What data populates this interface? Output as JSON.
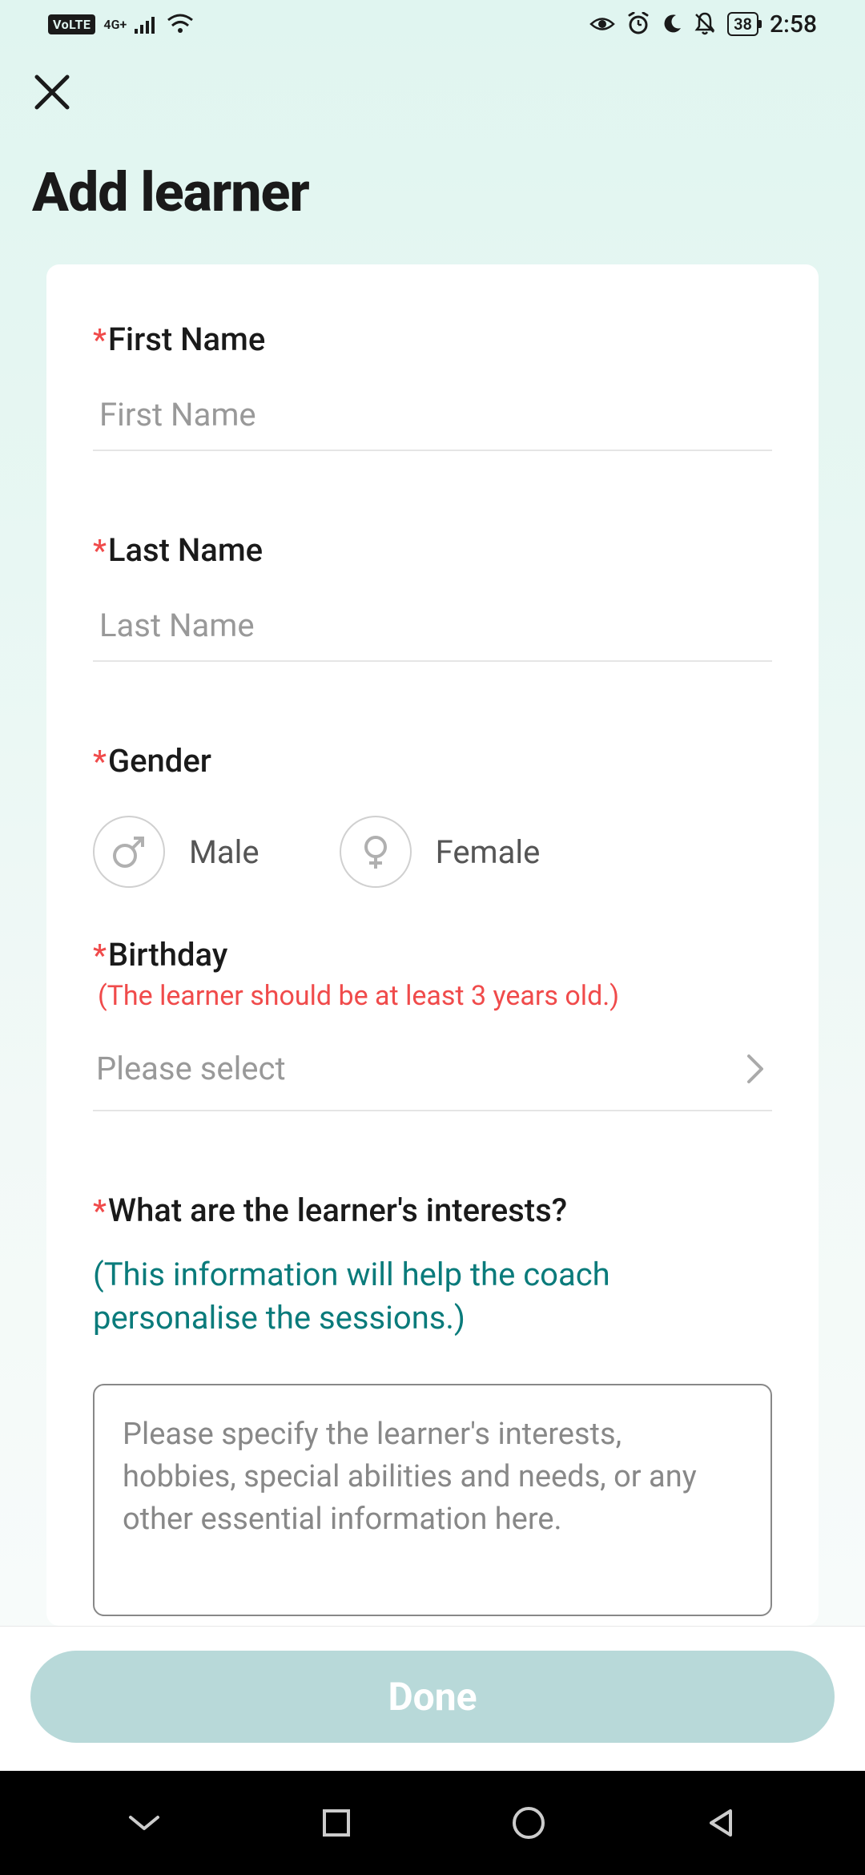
{
  "status_bar": {
    "volte": "VoLTE",
    "network": "4G+",
    "battery": "38",
    "time": "2:58"
  },
  "header": {
    "title": "Add learner"
  },
  "form": {
    "first_name": {
      "label": "First Name",
      "placeholder": "First Name",
      "value": ""
    },
    "last_name": {
      "label": "Last Name",
      "placeholder": "Last Name",
      "value": ""
    },
    "gender": {
      "label": "Gender",
      "options": {
        "male": "Male",
        "female": "Female"
      },
      "selected": null
    },
    "birthday": {
      "label": "Birthday",
      "hint": "(The learner should be at least 3 years old.)",
      "placeholder": "Please select",
      "value": ""
    },
    "interests": {
      "label": "What are the learner's interests?",
      "hint": "(This information will help the coach personalise the sessions.)",
      "placeholder": "Please specify the learner's interests, hobbies, special abilities and needs, or any other essential information here.",
      "value": ""
    }
  },
  "footer": {
    "done_label": "Done"
  }
}
